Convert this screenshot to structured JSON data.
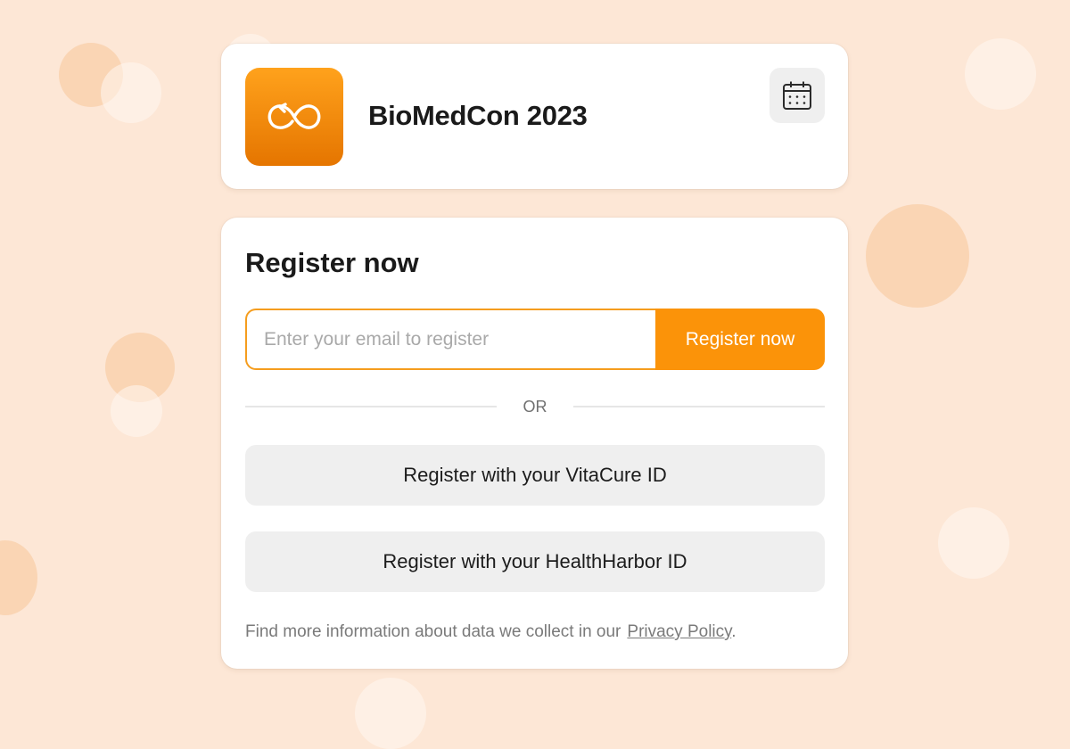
{
  "app": {
    "title": "BioMedCon 2023",
    "logo_icon": "infinity-arrow-icon",
    "calendar_icon": "calendar-icon"
  },
  "register": {
    "heading": "Register now",
    "email_placeholder": "Enter your email to register",
    "email_value": "",
    "submit_label": "Register now",
    "divider_text": "OR",
    "vitacure_label": "Register with your VitaCure ID",
    "healthharbor_label": "Register with your HealthHarbor ID",
    "privacy_text": "Find more information about data we collect in our",
    "privacy_link": "Privacy Policy",
    "privacy_suffix": "."
  },
  "colors": {
    "background": "#fde7d6",
    "accent": "#fb9309",
    "logo_gradient_top": "#ffa21c",
    "logo_gradient_bottom": "#e57500",
    "secondary_button": "#efefef"
  }
}
